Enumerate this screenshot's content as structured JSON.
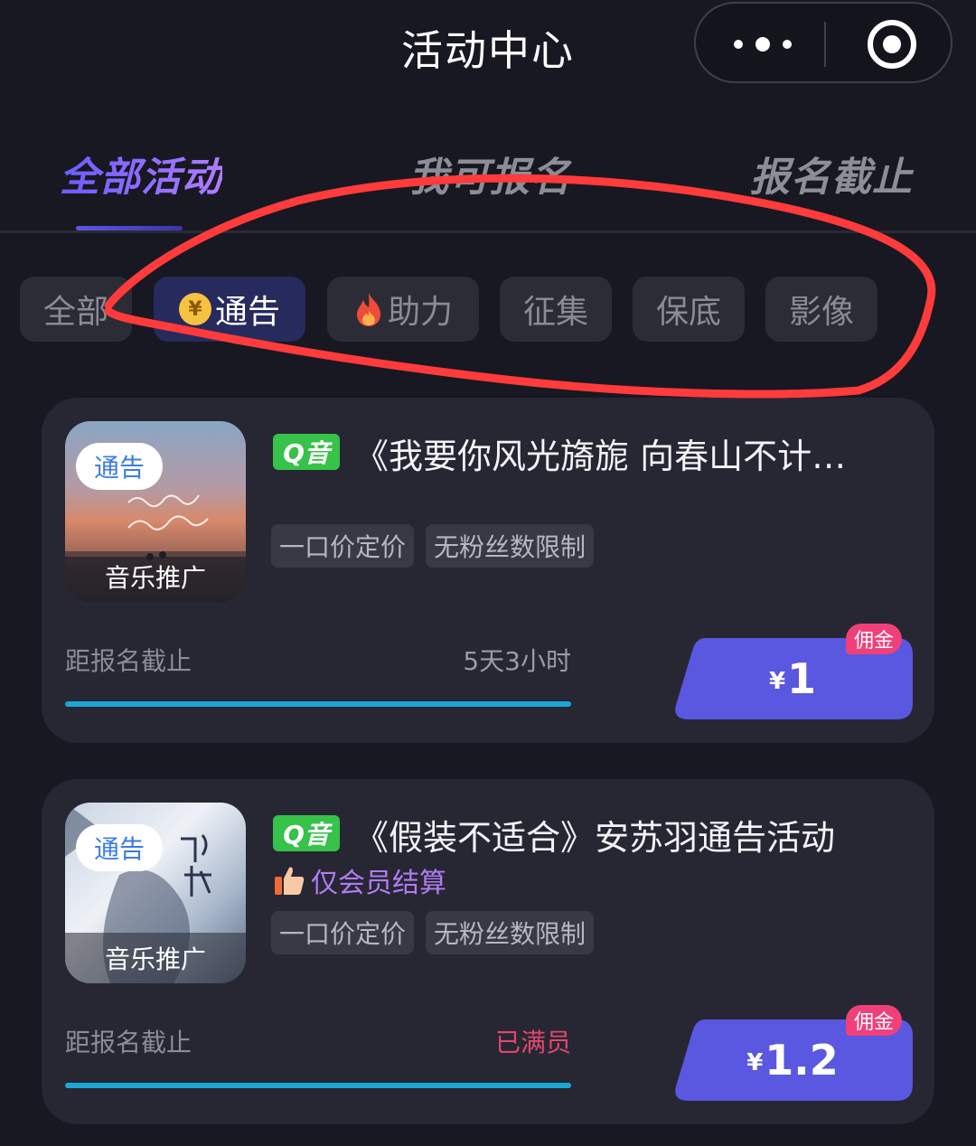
{
  "header": {
    "title": "活动中心",
    "menu_icon": "more-dots-icon",
    "close_icon": "target-close-icon"
  },
  "main_tabs": [
    {
      "label": "全部活动",
      "active": true
    },
    {
      "label": "我可报名",
      "active": false
    },
    {
      "label": "报名截止",
      "active": false
    }
  ],
  "filters": [
    {
      "label": "全部",
      "active": false
    },
    {
      "label": "通告",
      "active": true,
      "icon": "coin-yen-icon",
      "icon_text": "¥"
    },
    {
      "label": "助力",
      "active": false,
      "icon": "flame-icon"
    },
    {
      "label": "征集",
      "active": false
    },
    {
      "label": "保底",
      "active": false
    },
    {
      "label": "影像",
      "active": false
    }
  ],
  "colors": {
    "background": "#171822",
    "card": "#262733",
    "accent": "#5b57e6",
    "progress": "#1aa7d8",
    "annotation": "#ff3b3b",
    "full_status": "#e3466e"
  },
  "cards": [
    {
      "thumb_badge": "通告",
      "thumb_caption": "音乐推广",
      "platform": "Q音",
      "title": "《我要你风光旖旎 向春山不计…",
      "tags": [
        "一口价定价",
        "无粉丝数限制"
      ],
      "deadline_label": "距报名截止",
      "deadline_value": "5天3小时",
      "progress": 1.0,
      "commission_label": "佣金",
      "currency": "¥",
      "price": "1"
    },
    {
      "thumb_badge": "通告",
      "thumb_caption": "音乐推广",
      "platform": "Q音",
      "title": "《假装不适合》安苏羽通告活动",
      "member_note": "仅会员结算",
      "tags": [
        "一口价定价",
        "无粉丝数限制"
      ],
      "deadline_label": "距报名截止",
      "deadline_value": "已满员",
      "progress": 1.0,
      "commission_label": "佣金",
      "currency": "¥",
      "price": "1.2"
    }
  ]
}
